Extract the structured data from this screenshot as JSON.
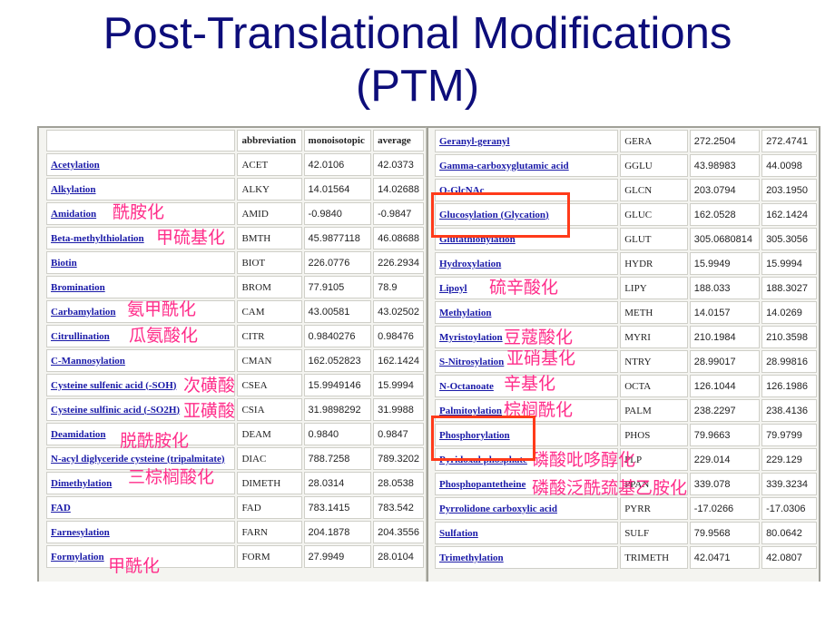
{
  "slide": {
    "title_line1": "Post-Translational Modifications",
    "title_line2": "(PTM)"
  },
  "table": {
    "headers": [
      "",
      "abbreviation",
      "monoisotopic",
      "average"
    ],
    "left_rows": [
      {
        "name": "Acetylation",
        "abbr": "ACET",
        "mono": "42.0106",
        "avg": "42.0373"
      },
      {
        "name": "Alkylation",
        "abbr": "ALKY",
        "mono": "14.01564",
        "avg": "14.02688"
      },
      {
        "name": "Amidation",
        "abbr": "AMID",
        "mono": "-0.9840",
        "avg": "-0.9847"
      },
      {
        "name": "Beta-methylthiolation",
        "abbr": "BMTH",
        "mono": "45.9877118",
        "avg": "46.08688"
      },
      {
        "name": "Biotin",
        "abbr": "BIOT",
        "mono": "226.0776",
        "avg": "226.2934"
      },
      {
        "name": "Bromination",
        "abbr": "BROM",
        "mono": "77.9105",
        "avg": "78.9"
      },
      {
        "name": "Carbamylation",
        "abbr": "CAM",
        "mono": "43.00581",
        "avg": "43.02502"
      },
      {
        "name": "Citrullination",
        "abbr": "CITR",
        "mono": "0.9840276",
        "avg": "0.98476"
      },
      {
        "name": "C-Mannosylation",
        "abbr": "CMAN",
        "mono": "162.052823",
        "avg": "162.1424"
      },
      {
        "name": "Cysteine sulfenic acid (-SOH)",
        "abbr": "CSEA",
        "mono": "15.9949146",
        "avg": "15.9994"
      },
      {
        "name": "Cysteine sulfinic acid (-SO2H)",
        "abbr": "CSIA",
        "mono": "31.9898292",
        "avg": "31.9988"
      },
      {
        "name": "Deamidation",
        "abbr": "DEAM",
        "mono": "0.9840",
        "avg": "0.9847"
      },
      {
        "name": "N-acyl diglyceride cysteine (tripalmitate)",
        "abbr": "DIAC",
        "mono": "788.7258",
        "avg": "789.3202"
      },
      {
        "name": "Dimethylation",
        "abbr": "DIMETH",
        "mono": "28.0314",
        "avg": "28.0538"
      },
      {
        "name": "FAD",
        "abbr": "FAD",
        "mono": "783.1415",
        "avg": "783.542"
      },
      {
        "name": "Farnesylation",
        "abbr": "FARN",
        "mono": "204.1878",
        "avg": "204.3556"
      },
      {
        "name": "Formylation",
        "abbr": "FORM",
        "mono": "27.9949",
        "avg": "28.0104"
      }
    ],
    "right_rows": [
      {
        "name": "Geranyl-geranyl",
        "abbr": "GERA",
        "mono": "272.2504",
        "avg": "272.4741"
      },
      {
        "name": "Gamma-carboxyglutamic acid",
        "abbr": "GGLU",
        "mono": "43.98983",
        "avg": "44.0098"
      },
      {
        "name": "O-GlcNAc",
        "abbr": "GLCN",
        "mono": "203.0794",
        "avg": "203.1950"
      },
      {
        "name": "Glucosylation (Glycation)",
        "abbr": "GLUC",
        "mono": "162.0528",
        "avg": "162.1424"
      },
      {
        "name": "Glutathionylation",
        "abbr": "GLUT",
        "mono": "305.0680814",
        "avg": "305.3056"
      },
      {
        "name": "Hydroxylation",
        "abbr": "HYDR",
        "mono": "15.9949",
        "avg": "15.9994"
      },
      {
        "name": "Lipoyl",
        "abbr": "LIPY",
        "mono": "188.033",
        "avg": "188.3027"
      },
      {
        "name": "Methylation",
        "abbr": "METH",
        "mono": "14.0157",
        "avg": "14.0269"
      },
      {
        "name": "Myristoylation",
        "abbr": "MYRI",
        "mono": "210.1984",
        "avg": "210.3598"
      },
      {
        "name": "S-Nitrosylation",
        "abbr": "NTRY",
        "mono": "28.99017",
        "avg": "28.99816"
      },
      {
        "name": "N-Octanoate",
        "abbr": "OCTA",
        "mono": "126.1044",
        "avg": "126.1986"
      },
      {
        "name": "Palmitoylation",
        "abbr": "PALM",
        "mono": "238.2297",
        "avg": "238.4136"
      },
      {
        "name": "Phosphorylation",
        "abbr": "PHOS",
        "mono": "79.9663",
        "avg": "79.9799"
      },
      {
        "name": "Pyridoxal phosphate",
        "abbr": "PLP",
        "mono": "229.014",
        "avg": "229.129"
      },
      {
        "name": "Phosphopantetheine",
        "abbr": "PPAN",
        "mono": "339.078",
        "avg": "339.3234"
      },
      {
        "name": "Pyrrolidone carboxylic acid",
        "abbr": "PYRR",
        "mono": "-17.0266",
        "avg": "-17.0306"
      },
      {
        "name": "Sulfation",
        "abbr": "SULF",
        "mono": "79.9568",
        "avg": "80.0642"
      },
      {
        "name": "Trimethylation",
        "abbr": "TRIMETH",
        "mono": "42.0471",
        "avg": "42.0807"
      }
    ]
  },
  "annotations": {
    "amidation": "酰胺化",
    "beta_methylthiolation": "甲硫基化",
    "carbamylation": "氨甲酰化",
    "citrullination": "瓜氨酸化",
    "cysteine_sulfenic": "次磺酸",
    "cysteine_sulfinic": "亚磺酸",
    "deamidation": "脱酰胺化",
    "tripalmitate": "三棕榈酸化",
    "formylation": "甲酰化",
    "lipoyl": "硫辛酸化",
    "myristoylation": "豆蔻酸化",
    "nitrosylation": "亚硝基化",
    "octanoate": "辛基化",
    "palmitoylation": "棕榈酰化",
    "pyridoxal": "磷酸吡哆醇化",
    "phosphopantetheine": "磷酸泛酰巯基乙胺化"
  },
  "colors": {
    "title": "#0d0d7a",
    "link": "#1a1aa8",
    "annotation": "#ff2d8a",
    "highlight_box": "#ff3b1a"
  }
}
